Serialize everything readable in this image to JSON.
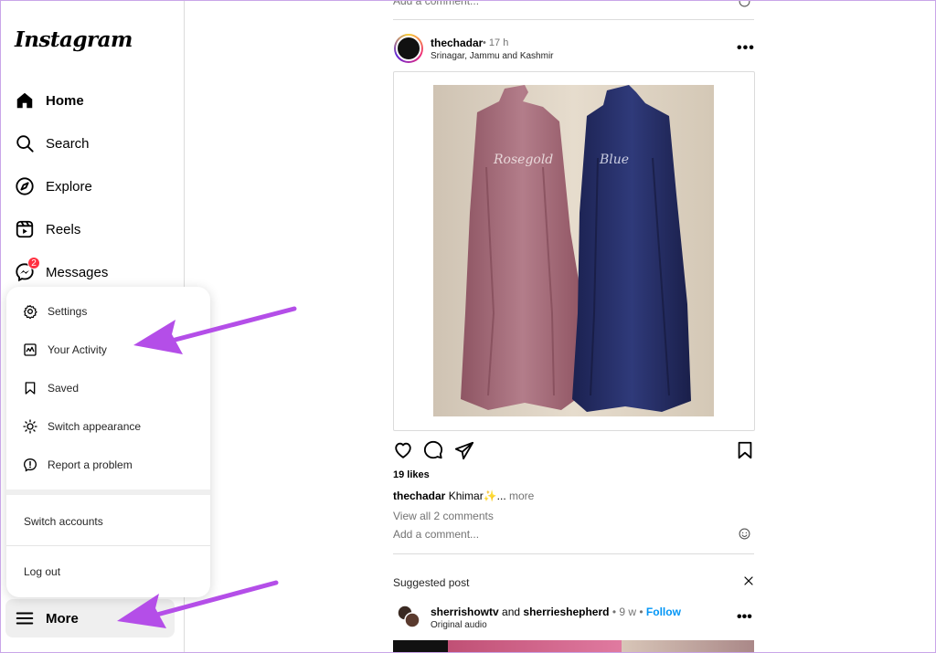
{
  "sidebar": {
    "logo": "Instagram",
    "nav": [
      {
        "label": "Home",
        "icon": "home-icon"
      },
      {
        "label": "Search",
        "icon": "search-icon"
      },
      {
        "label": "Explore",
        "icon": "compass-icon"
      },
      {
        "label": "Reels",
        "icon": "reels-icon"
      },
      {
        "label": "Messages",
        "icon": "messenger-icon",
        "badge": "2"
      }
    ],
    "more_label": "More"
  },
  "more_menu": {
    "items": [
      {
        "label": "Settings",
        "icon": "gear-icon"
      },
      {
        "label": "Your Activity",
        "icon": "activity-icon"
      },
      {
        "label": "Saved",
        "icon": "bookmark-icon"
      },
      {
        "label": "Switch appearance",
        "icon": "sun-icon"
      },
      {
        "label": "Report a problem",
        "icon": "report-icon"
      }
    ],
    "switch_accounts": "Switch accounts",
    "log_out": "Log out"
  },
  "feed": {
    "prev_comment_placeholder": "Add a comment...",
    "post": {
      "username": "thechadar",
      "time": "• 17 h",
      "location": "Srinagar, Jammu and Kashmir",
      "image_labels": [
        "Rosegold",
        "Blue"
      ],
      "likes": "19 likes",
      "caption_user": "thechadar",
      "caption_text": "Khimar✨...",
      "caption_more": "more",
      "view_comments": "View all 2 comments",
      "comment_placeholder": "Add a comment..."
    },
    "suggested": {
      "title": "Suggested post",
      "user1": "sherrishowtv",
      "and": "and",
      "user2": "sherrieshepherd",
      "time": "• 9 w •",
      "follow": "Follow",
      "audio": "Original audio"
    }
  },
  "colors": {
    "badge": "#ff3040",
    "follow": "#0095f6",
    "annotation_arrow": "#b44ee8",
    "dress_rosegold": "#a56a78",
    "dress_blue": "#263063"
  }
}
